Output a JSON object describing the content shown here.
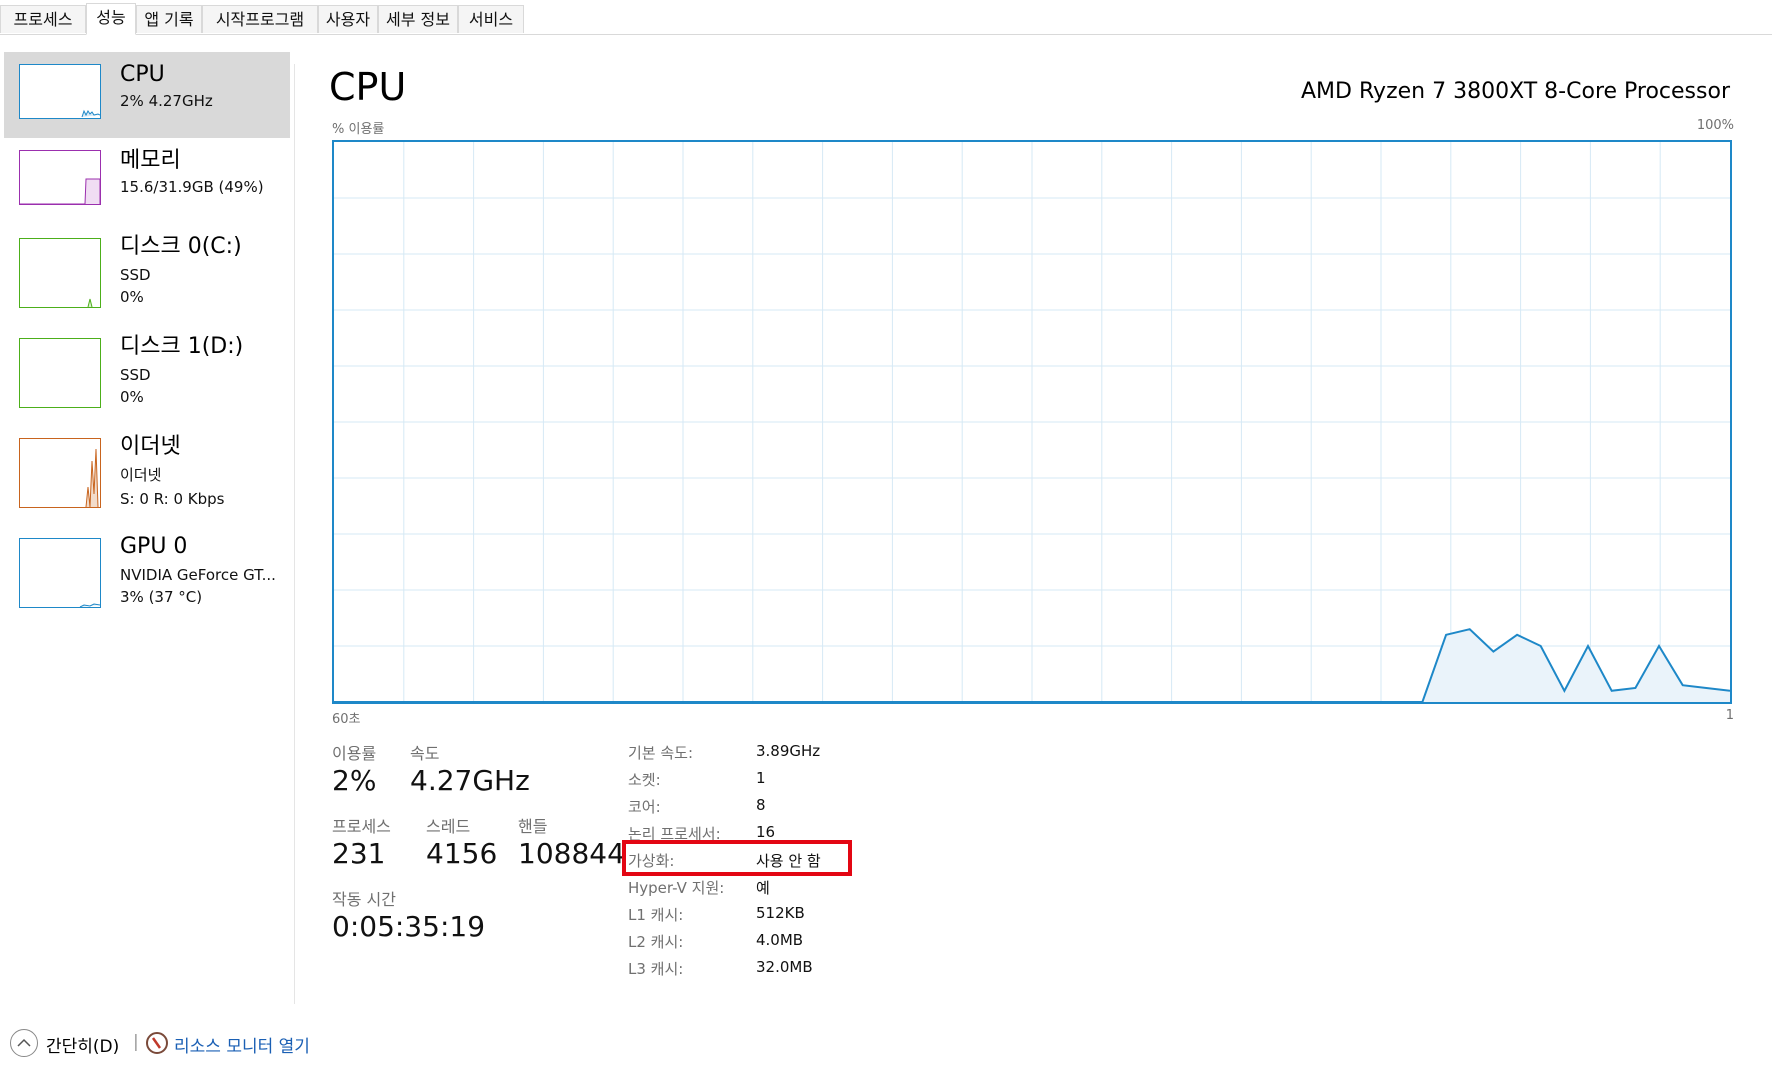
{
  "tabs": [
    "프로세스",
    "성능",
    "앱 기록",
    "시작프로그램",
    "사용자",
    "세부 정보",
    "서비스"
  ],
  "active_tab": "성능",
  "sidebar": {
    "items": [
      {
        "title": "CPU",
        "sub1": "2% 4.27GHz",
        "sub2": "",
        "color": "#1e88c8"
      },
      {
        "title": "메모리",
        "sub1": "15.6/31.9GB (49%)",
        "sub2": "",
        "color": "#9b2fae"
      },
      {
        "title": "디스크 0(C:)",
        "sub1": "SSD",
        "sub2": "0%",
        "color": "#4caf1a"
      },
      {
        "title": "디스크 1(D:)",
        "sub1": "SSD",
        "sub2": "0%",
        "color": "#4caf1a"
      },
      {
        "title": "이더넷",
        "sub1": "이더넷",
        "sub2": "S: 0 R: 0 Kbps",
        "color": "#c8641e"
      },
      {
        "title": "GPU 0",
        "sub1": "NVIDIA GeForce GT...",
        "sub2": "3% (37 °C)",
        "color": "#1e88c8"
      }
    ]
  },
  "main": {
    "title": "CPU",
    "processor": "AMD Ryzen 7 3800XT 8-Core Processor",
    "graph_ylabel": "% 이용률",
    "graph_ymax": "100%",
    "graph_xleft": "60초",
    "graph_xright": "1",
    "accent": "#1e88c8"
  },
  "chart_data": {
    "type": "area",
    "ylim": [
      0,
      100
    ],
    "values": [
      0,
      0,
      0,
      0,
      0,
      0,
      0,
      0,
      0,
      0,
      0,
      0,
      0,
      0,
      0,
      0,
      0,
      0,
      0,
      0,
      0,
      0,
      0,
      0,
      0,
      0,
      0,
      0,
      0,
      0,
      0,
      0,
      0,
      0,
      0,
      0,
      0,
      0,
      0,
      0,
      0,
      0,
      0,
      0,
      0,
      0,
      0,
      12,
      13,
      9,
      12,
      10,
      2,
      10,
      2,
      2.5,
      10,
      3,
      2.5,
      2
    ]
  },
  "stats": {
    "usage_label": "이용률",
    "usage_value": "2%",
    "speed_label": "속도",
    "speed_value": "4.27GHz",
    "processes_label": "프로세스",
    "processes_value": "231",
    "threads_label": "스레드",
    "threads_value": "4156",
    "handles_label": "핸들",
    "handles_value": "108844",
    "uptime_label": "작동 시간",
    "uptime_value": "0:05:35:19"
  },
  "info": [
    {
      "label": "기본 속도:",
      "value": "3.89GHz"
    },
    {
      "label": "소켓:",
      "value": "1"
    },
    {
      "label": "코어:",
      "value": "8"
    },
    {
      "label": "논리 프로세서:",
      "value": "16"
    },
    {
      "label": "가상화:",
      "value": "사용 안 함"
    },
    {
      "label": "Hyper-V 지원:",
      "value": "예"
    },
    {
      "label": "L1 캐시:",
      "value": "512KB"
    },
    {
      "label": "L2 캐시:",
      "value": "4.0MB"
    },
    {
      "label": "L3 캐시:",
      "value": "32.0MB"
    }
  ],
  "footer": {
    "fewer_details": "간단히(D)",
    "separator": "|",
    "resource_monitor": "리소스 모니터 열기"
  }
}
